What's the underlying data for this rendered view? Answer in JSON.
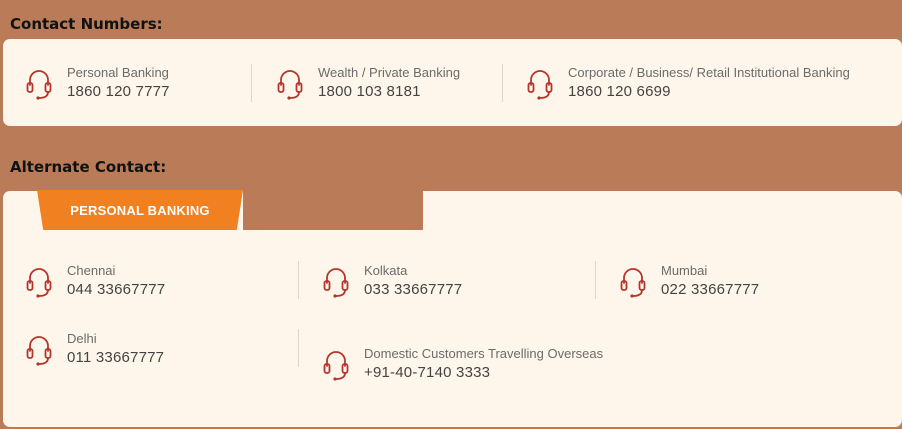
{
  "sections": {
    "contact_numbers_title": "Contact Numbers:",
    "alternate_contact_title": "Alternate Contact:"
  },
  "contact_numbers": [
    {
      "label": "Personal Banking",
      "number": "1860 120 7777"
    },
    {
      "label": "Wealth / Private Banking",
      "number": "1800 103 8181"
    },
    {
      "label": "Corporate / Business/ Retail Institutional Banking",
      "number": "1860 120 6699"
    }
  ],
  "alternate": {
    "tabs": [
      {
        "label": "PERSONAL BANKING",
        "active": true
      },
      {
        "label": "",
        "active": false
      }
    ],
    "contacts": [
      {
        "label": "Chennai",
        "number": "044 33667777"
      },
      {
        "label": "Kolkata",
        "number": "033 33667777"
      },
      {
        "label": "Mumbai",
        "number": "022 33667777"
      },
      {
        "label": "Delhi",
        "number": "011 33667777"
      },
      {
        "label": "Domestic Customers Travelling Overseas",
        "number": "+91-40-7140 3333"
      }
    ]
  },
  "icons": {
    "contact": "headset-icon"
  },
  "colors": {
    "background": "#b97b58",
    "card": "#fef6ea",
    "accent": "#f08020",
    "icon": "#b5352d"
  }
}
